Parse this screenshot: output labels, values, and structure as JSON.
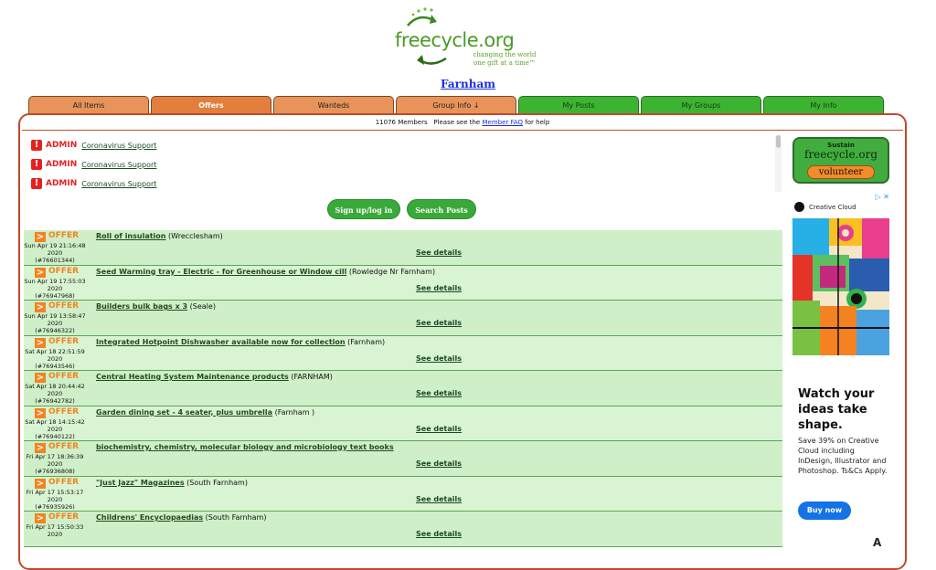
{
  "header": {
    "logo_text": "freecycle.org",
    "tagline_1": "changing the world",
    "tagline_2": "one gift at a time™",
    "group_name": "Farnham"
  },
  "tabs": [
    {
      "label": "All Items"
    },
    {
      "label": "Offers"
    },
    {
      "label": "Wanteds"
    },
    {
      "label": "Group Info ↓"
    },
    {
      "label": "My Posts"
    },
    {
      "label": "My Groups"
    },
    {
      "label": "My Info"
    }
  ],
  "members_bar": {
    "count": "11076 Members",
    "text_before": "Please see the",
    "link": "Member FAQ",
    "text_after": "for help"
  },
  "admin_notices": [
    {
      "label": "ADMIN",
      "link": "Coronavirus Support"
    },
    {
      "label": "ADMIN",
      "link": "Coronavirus Support"
    },
    {
      "label": "ADMIN",
      "link": "Coronavirus Support"
    }
  ],
  "buttons": {
    "signup": "Sign up/log in",
    "search": "Search Posts"
  },
  "posts": [
    {
      "type": "OFFER",
      "title": "Roll of insulation",
      "location": "(Wrecclesham)",
      "date": "Sun Apr 19 21:16:48",
      "year": "2020",
      "id": "(#76601344)",
      "details": "See details"
    },
    {
      "type": "OFFER",
      "title": "Seed Warming tray - Electric - for Greenhouse or Window cill",
      "location": "(Rowledge Nr Farnham)",
      "date": "Sun Apr 19 17:55:03",
      "year": "2020",
      "id": "(#76947968)",
      "details": "See details"
    },
    {
      "type": "OFFER",
      "title": "Builders bulk bags x 3",
      "location": "(Seale)",
      "date": "Sun Apr 19 13:58:47",
      "year": "2020",
      "id": "(#76946322)",
      "details": "See details"
    },
    {
      "type": "OFFER",
      "title": "Integrated Hotpoint Dishwasher available now for collection",
      "location": "(Farnham)",
      "date": "Sat Apr 18 22:51:59",
      "year": "2020",
      "id": "(#76943546)",
      "details": "See details"
    },
    {
      "type": "OFFER",
      "title": "Central Heating System Maintenance products",
      "location": "(FARNHAM)",
      "date": "Sat Apr 18 20:44:42",
      "year": "2020",
      "id": "(#76942782)",
      "details": "See details"
    },
    {
      "type": "OFFER",
      "title": "Garden dining set - 4 seater, plus umbrella",
      "location": "(Farnham )",
      "date": "Sat Apr 18 14:15:42",
      "year": "2020",
      "id": "(#76940122)",
      "details": "See details"
    },
    {
      "type": "OFFER",
      "title": "biochemistry, chemistry, molecular biology and microbiology text books",
      "location": "",
      "date": "Fri Apr 17 18:36:39",
      "year": "2020",
      "id": "(#76936808)",
      "details": "See details"
    },
    {
      "type": "OFFER",
      "title": "\"Just Jazz\" Magazines",
      "location": "(South Farnham)",
      "date": "Fri Apr 17 15:53:17",
      "year": "2020",
      "id": "(#76935926)",
      "details": "See details"
    },
    {
      "type": "OFFER",
      "title": "Childrens' Encyclopaedias",
      "location": "(South Farnham)",
      "date": "Fri Apr 17 15:50:33",
      "year": "2020",
      "id": "",
      "details": "See details"
    }
  ],
  "sidebar": {
    "sustain_line1": "Sustain",
    "sustain_line2": "freecycle.org",
    "sustain_button": "volunteer"
  },
  "ad": {
    "close": "▷ ✕",
    "brand": "Creative Cloud",
    "headline": "Watch your ideas take shape.",
    "body": "Save 39% on Creative Cloud including InDesign, Illustrator and Photoshop. Ts&Cs Apply.",
    "cta": "Buy now",
    "logo_letter": "A"
  },
  "colors": {
    "tab_orange": "#e8935a",
    "tab_green": "#3cb431",
    "frame_border": "#c14a2a",
    "offer_orange": "#f5821e",
    "admin_red": "#e52020",
    "link_blue": "#1a2ee0"
  }
}
